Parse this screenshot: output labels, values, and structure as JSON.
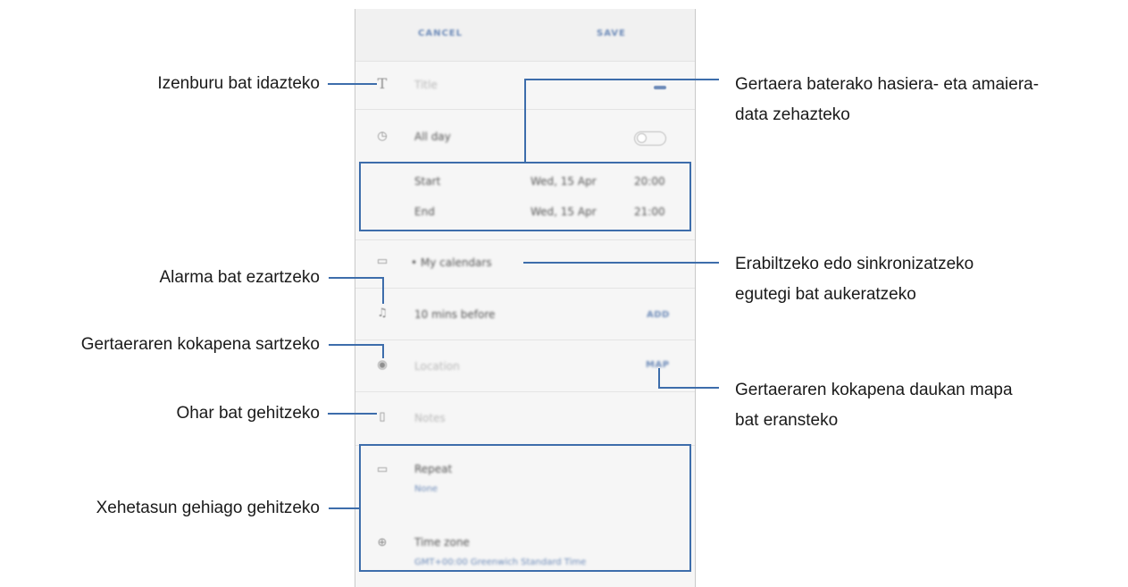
{
  "screen": {
    "cancel_label": "CANCEL",
    "save_label": "SAVE",
    "title_placeholder": "Title",
    "all_day_label": "All day",
    "start_label": "Start",
    "start_date": "Wed, 15 Apr",
    "start_time": "20:00",
    "end_label": "End",
    "end_date": "Wed, 15 Apr",
    "end_time": "21:00",
    "calendar_label": "• My calendars",
    "alarm_label": "10 mins before",
    "alarm_add": "ADD",
    "location_placeholder": "Location",
    "map_label": "MAP",
    "notes_placeholder": "Notes",
    "repeat_label": "Repeat",
    "repeat_value": "None",
    "timezone_label": "Time zone",
    "timezone_value": "GMT+00:00 Greenwich Standard Time"
  },
  "callouts": {
    "title": "Izenburu bat idazteko",
    "dates_line1": "Gertaera baterako hasiera- eta amaiera-",
    "dates_line2": "data zehazteko",
    "calendar_line1": "Erabiltzeko edo sinkronizatzeko",
    "calendar_line2": "egutegi bat aukeratzeko",
    "alarm": "Alarma bat ezartzeko",
    "location": "Gertaeraren kokapena sartzeko",
    "map_line1": "Gertaeraren kokapena daukan mapa",
    "map_line2": "bat eransteko",
    "notes": "Ohar bat gehitzeko",
    "more": "Xehetasun gehiago gehitzeko"
  },
  "colors": {
    "accent": "#3d6dab",
    "screen_bg": "#f6f6f6"
  },
  "icons": [
    "text-icon",
    "clock-icon",
    "calendar-icon",
    "bell-icon",
    "location-pin-icon",
    "note-icon",
    "repeat-icon",
    "globe-icon"
  ]
}
